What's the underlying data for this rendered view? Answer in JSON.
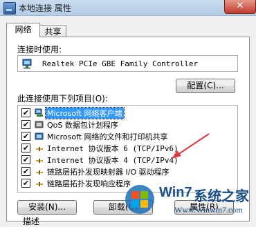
{
  "window": {
    "title": "本地连接 属性",
    "close_glyph": "✕"
  },
  "tabs": [
    {
      "label": "网络",
      "active": true
    },
    {
      "label": "共享",
      "active": false
    }
  ],
  "connect_using": {
    "label_prefix": "连接时使用",
    "label_suffix": ":",
    "adapter": "Realtek PCIe GBE Family Controller",
    "configure_label": "配置(C)..."
  },
  "items_section": {
    "label_prefix": "此连接使用下列项目",
    "label_hotkey": "(O)",
    "label_suffix": ":",
    "items": [
      {
        "label": "Microsoft 网络客户端",
        "checked": true,
        "selected": true,
        "icon": "network-client-icon"
      },
      {
        "label": "QoS 数据包计划程序",
        "checked": true,
        "selected": false,
        "icon": "qos-icon"
      },
      {
        "label": "Microsoft 网络的文件和打印机共享",
        "checked": true,
        "selected": false,
        "icon": "file-share-icon"
      },
      {
        "label": "Internet 协议版本 6 (TCP/IPv6)",
        "checked": true,
        "selected": false,
        "icon": "protocol-icon"
      },
      {
        "label": "Internet 协议版本 4 (TCP/IPv4)",
        "checked": true,
        "selected": false,
        "icon": "protocol-icon"
      },
      {
        "label": "链路层拓扑发现映射器 I/O 驱动程序",
        "checked": true,
        "selected": false,
        "icon": "protocol-icon"
      },
      {
        "label": "链路层拓扑发现响应程序",
        "checked": true,
        "selected": false,
        "icon": "protocol-icon"
      }
    ]
  },
  "buttons": {
    "install": "安装(N)...",
    "uninstall": "卸载(U)",
    "properties": "属性(R)"
  },
  "description_label": "描述",
  "watermark": {
    "brand": "Win7",
    "brand_suffix": "系统之家",
    "url": "Www.Winwin7.com"
  },
  "colors": {
    "selection": "#3399ff",
    "arrow": "#e0393e"
  }
}
